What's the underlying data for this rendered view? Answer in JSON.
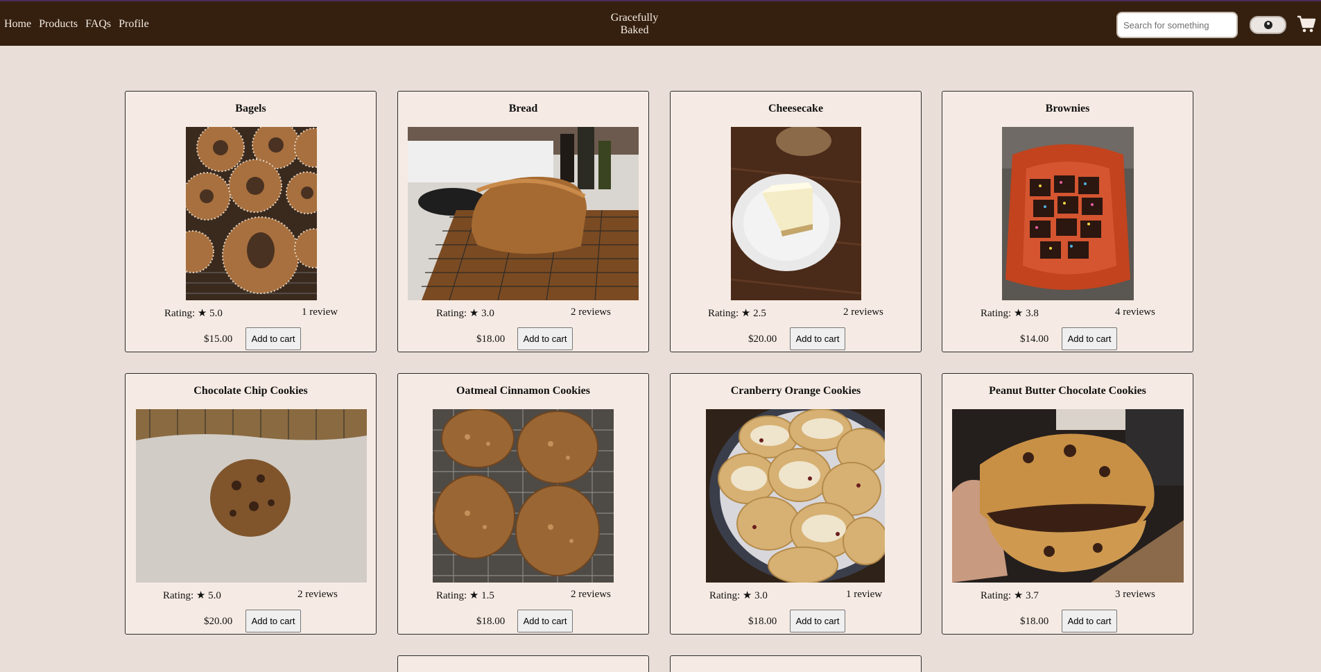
{
  "nav": {
    "home": "Home",
    "products": "Products",
    "faqs": "FAQs",
    "profile": "Profile"
  },
  "brand": {
    "line1": "Gracefully",
    "line2": "Baked"
  },
  "search": {
    "placeholder": "Search for something",
    "value": ""
  },
  "icons": {
    "profile": "user-circle-icon",
    "cart": "shopping-cart-icon"
  },
  "colors": {
    "header": "#35200f",
    "page": "#e9dfd8",
    "card": "#f6ebe4"
  },
  "products": [
    {
      "name": "Bagels",
      "rating": "Rating: ★ 5.0",
      "reviews": "1 review",
      "price": "$15.00",
      "button": "Add to cart"
    },
    {
      "name": "Bread",
      "rating": "Rating: ★ 3.0",
      "reviews": "2 reviews",
      "price": "$18.00",
      "button": "Add to cart"
    },
    {
      "name": "Cheesecake",
      "rating": "Rating: ★ 2.5",
      "reviews": "2 reviews",
      "price": "$20.00",
      "button": "Add to cart"
    },
    {
      "name": "Brownies",
      "rating": "Rating: ★ 3.8",
      "reviews": "4 reviews",
      "price": "$14.00",
      "button": "Add to cart"
    },
    {
      "name": "Chocolate Chip Cookies",
      "rating": "Rating: ★ 5.0",
      "reviews": "2 reviews",
      "price": "$20.00",
      "button": "Add to cart"
    },
    {
      "name": "Oatmeal Cinnamon Cookies",
      "rating": "Rating: ★ 1.5",
      "reviews": "2 reviews",
      "price": "$18.00",
      "button": "Add to cart"
    },
    {
      "name": "Cranberry Orange Cookies",
      "rating": "Rating: ★ 3.0",
      "reviews": "1 review",
      "price": "$18.00",
      "button": "Add to cart"
    },
    {
      "name": "Peanut Butter Chocolate Cookies",
      "rating": "Rating: ★ 3.7",
      "reviews": "3 reviews",
      "price": "$18.00",
      "button": "Add to cart"
    }
  ]
}
